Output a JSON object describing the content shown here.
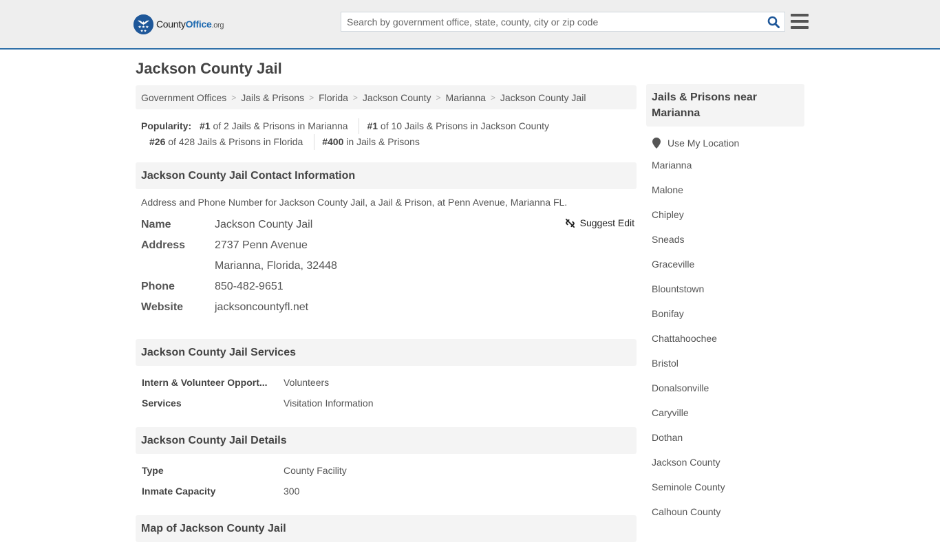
{
  "header": {
    "logo": {
      "prefix": "County",
      "brand": "Office",
      "suffix": ".org"
    },
    "search": {
      "placeholder": "Search by government office, state, county, city or zip code",
      "value": ""
    },
    "icons": {
      "search": "search-icon",
      "menu": "hamburger-menu-icon"
    }
  },
  "page": {
    "title": "Jackson County Jail"
  },
  "breadcrumb": [
    "Government Offices",
    "Jails & Prisons",
    "Florida",
    "Jackson County",
    "Marianna",
    "Jackson County Jail"
  ],
  "breadcrumb_separator": ">",
  "popularity": {
    "label": "Popularity:",
    "items": [
      {
        "rank": "#1",
        "text": " of 2 Jails & Prisons in Marianna"
      },
      {
        "rank": "#1",
        "text": " of 10 Jails & Prisons in Jackson County"
      },
      {
        "rank": "#26",
        "text": " of 428 Jails & Prisons in Florida"
      },
      {
        "rank": "#400",
        "text": " in Jails & Prisons"
      }
    ]
  },
  "contact": {
    "heading": "Jackson County Jail Contact Information",
    "description": "Address and Phone Number for Jackson County Jail, a Jail & Prison, at Penn Avenue, Marianna FL.",
    "suggest_edit": "Suggest Edit",
    "name_label": "Name",
    "name": "Jackson County Jail",
    "address_label": "Address",
    "address_line1": "2737 Penn Avenue",
    "address_line2": "Marianna, Florida, 32448",
    "phone_label": "Phone",
    "phone": "850-482-9651",
    "website_label": "Website",
    "website": "jacksoncountyfl.net"
  },
  "services": {
    "heading": "Jackson County Jail Services",
    "rows": [
      {
        "key": "Intern & Volunteer Opport...",
        "value": "Volunteers"
      },
      {
        "key": "Services",
        "value": "Visitation Information"
      }
    ]
  },
  "details": {
    "heading": "Jackson County Jail Details",
    "rows": [
      {
        "key": "Type",
        "value": "County Facility"
      },
      {
        "key": "Inmate Capacity",
        "value": "300"
      }
    ]
  },
  "map": {
    "heading": "Map of Jackson County Jail"
  },
  "sidebar": {
    "heading": "Jails & Prisons near Marianna",
    "use_location": "Use My Location",
    "links": [
      "Marianna",
      "Malone",
      "Chipley",
      "Sneads",
      "Graceville",
      "Blountstown",
      "Bonifay",
      "Chattahoochee",
      "Bristol",
      "Donalsonville",
      "Caryville",
      "Dothan",
      "Jackson County",
      "Seminole County",
      "Calhoun County"
    ]
  },
  "colors": {
    "brand_blue": "#1e5799",
    "header_border": "#3071a9",
    "search_icon": "#1e5799"
  }
}
